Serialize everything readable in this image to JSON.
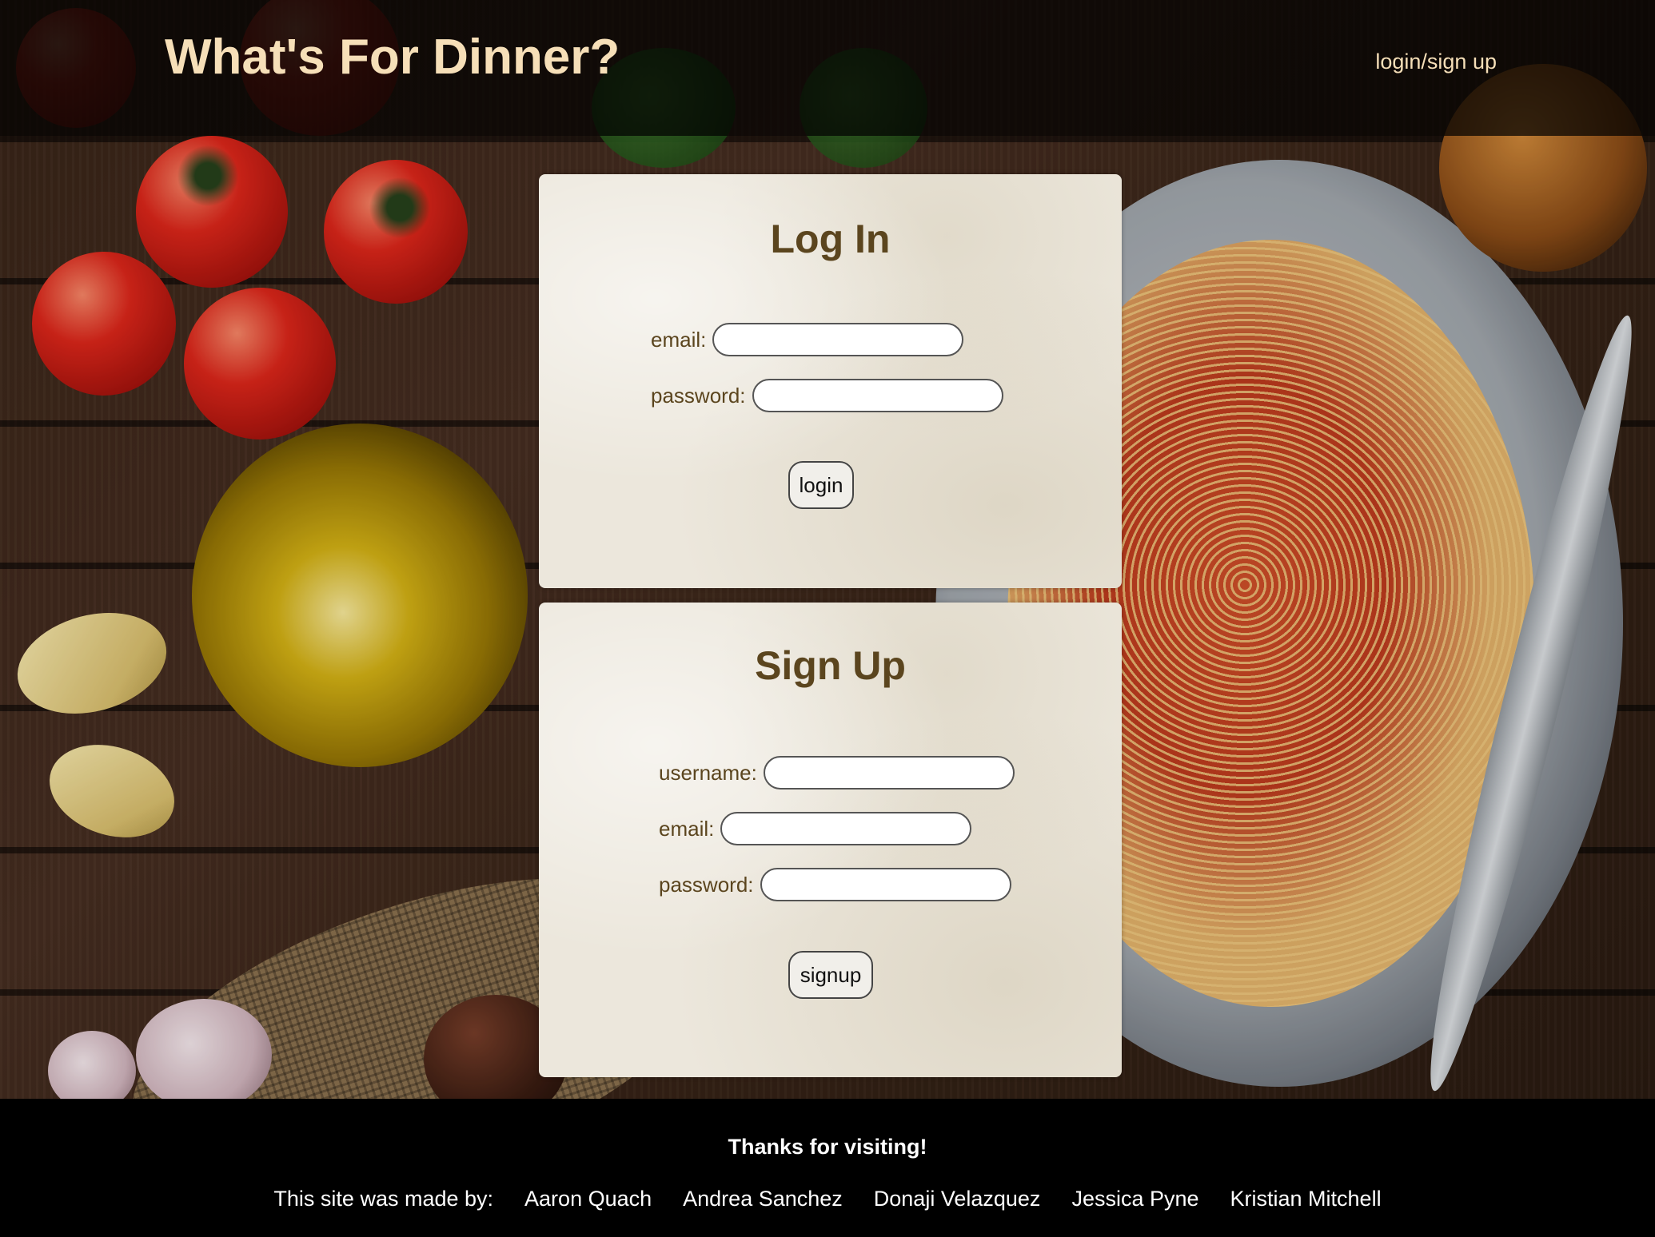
{
  "header": {
    "site_title": "What's For Dinner?",
    "nav_link": "login/sign up"
  },
  "login": {
    "title": "Log In",
    "email_label": "email:",
    "password_label": "password:",
    "email_value": "",
    "password_value": "",
    "button_label": "login"
  },
  "signup": {
    "title": "Sign Up",
    "username_label": "username:",
    "email_label": "email:",
    "password_label": "password:",
    "username_value": "",
    "email_value": "",
    "password_value": "",
    "button_label": "signup"
  },
  "footer": {
    "thanks": "Thanks for visiting!",
    "made_by_label": "This site was made by:",
    "authors": [
      "Aaron Quach",
      "Andrea Sanchez",
      "Donaji Velazquez",
      "Jessica Pyne",
      "Kristian Mitchell"
    ]
  },
  "colors": {
    "header_text": "#f6dfb8",
    "card_heading": "#5b451e",
    "footer_bg": "#000000"
  }
}
